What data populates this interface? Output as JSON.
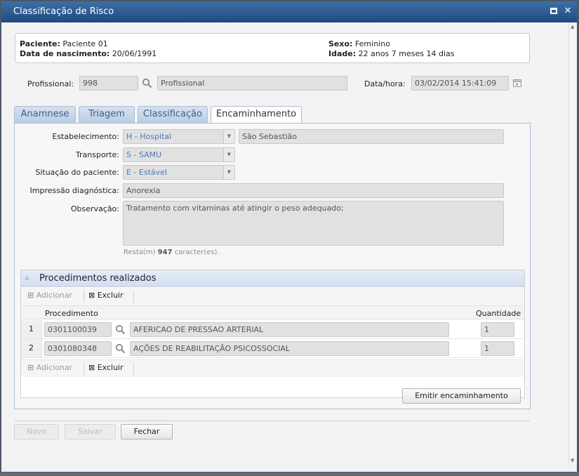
{
  "window": {
    "title": "Classificação de Risco",
    "maximize_icon": "maximize-icon",
    "close_glyph": "✕"
  },
  "patient": {
    "name_label": "Paciente:",
    "name": "Paciente 01",
    "birth_label": "Data de nascimento:",
    "birth": "20/06/1991",
    "sex_label": "Sexo:",
    "sex": "Feminino",
    "age_label": "Idade:",
    "age": "22 anos 7 meses 14 dias"
  },
  "professional": {
    "label": "Profissional:",
    "code": "998",
    "name": "Profissional"
  },
  "datetime": {
    "label": "Data/hora:",
    "value": "03/02/2014 15:41:09"
  },
  "tabs": [
    {
      "label": "Anamnese"
    },
    {
      "label": "Triagem"
    },
    {
      "label": "Classificação"
    },
    {
      "label": "Encaminhamento"
    }
  ],
  "form": {
    "establishment_label": "Estabelecimento:",
    "establishment_value": "H - Hospital",
    "establishment_name": "São Sebastião",
    "transport_label": "Transporte:",
    "transport_value": "S - SAMU",
    "situation_label": "Situação do paciente:",
    "situation_value": "E - Estável",
    "diagnosis_label": "Impressão diagnóstica:",
    "diagnosis_value": "Anorexia",
    "observation_label": "Observação:",
    "observation_value": "Tratamento com vitaminas até atingir o peso adequado;",
    "remaining_prefix": "Resta(m)",
    "remaining_count": "947",
    "remaining_suffix": "caracter(es)."
  },
  "procedures": {
    "title": "Procedimentos realizados",
    "add_label": "Adicionar",
    "delete_label": "Excluir",
    "col_procedure": "Procedimento",
    "col_quantity": "Quantidade",
    "rows": [
      {
        "num": "1",
        "code": "0301100039",
        "description": "AFERICAO DE PRESSAO ARTERIAL",
        "quantity": "1"
      },
      {
        "num": "2",
        "code": "0301080348",
        "description": "AÇÕES DE REABILITAÇÃO PSICOSSOCIAL",
        "quantity": "1"
      }
    ]
  },
  "actions": {
    "emit_referral": "Emitir encaminhamento",
    "new": "Novo",
    "save": "Salvar",
    "close": "Fechar"
  },
  "colors": {
    "titlebar": "#1f4a80",
    "tab_inactive_text": "#3c5f8e",
    "field_bg": "#e1e1e1"
  }
}
